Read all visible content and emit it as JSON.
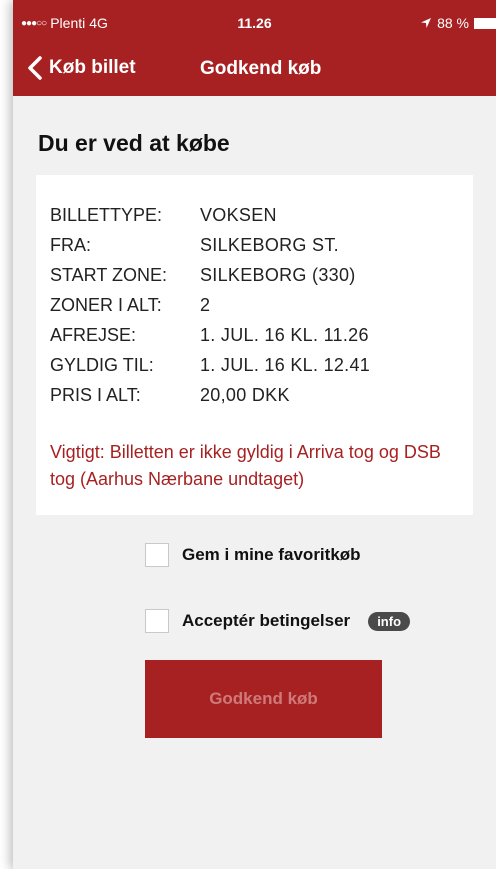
{
  "status": {
    "signal": "●●●○○",
    "carrier": "Plenti",
    "network": "4G",
    "time": "11.26",
    "battery": "88 %"
  },
  "nav": {
    "back_label": "Køb billet",
    "title": "Godkend køb"
  },
  "heading": "Du er ved at købe",
  "ticket": {
    "rows": [
      {
        "label": "BILLETTYPE:",
        "value": "VOKSEN"
      },
      {
        "label": "FRA:",
        "value": "SILKEBORG ST."
      },
      {
        "label": "START ZONE:",
        "value": "SILKEBORG (330)"
      },
      {
        "label": "ZONER I ALT:",
        "value": "2"
      },
      {
        "label": "AFREJSE:",
        "value": "1. JUL. 16 KL. 11.26"
      },
      {
        "label": "GYLDIG TIL:",
        "value": "1. JUL. 16 KL. 12.41"
      },
      {
        "label": "PRIS I ALT:",
        "value": "20,00 DKK"
      }
    ],
    "note": "Vigtigt: Billetten er ikke gyldig i Arriva tog og DSB tog (Aarhus Nærbane undtaget)"
  },
  "options": {
    "favorite_label": "Gem i mine favoritkøb",
    "accept_label": "Acceptér betingelser",
    "info_label": "info"
  },
  "confirm_label": "Godkend køb",
  "colors": {
    "accent": "#a82122",
    "background": "#f1f1f1"
  }
}
